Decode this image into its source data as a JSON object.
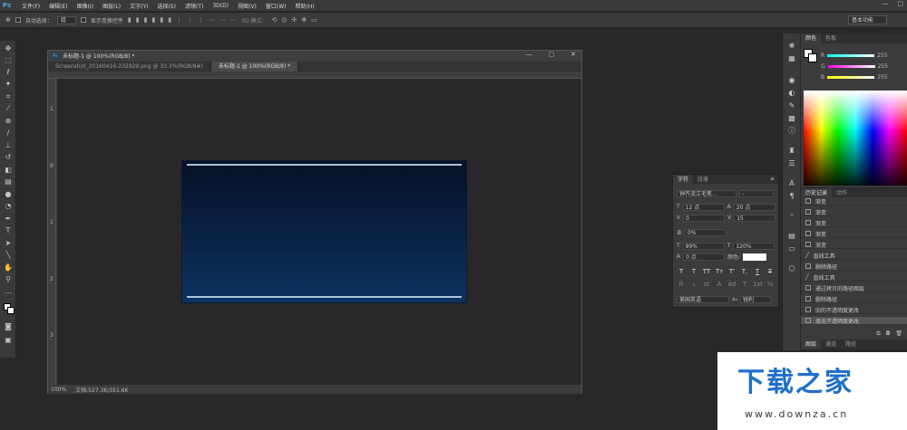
{
  "app": {
    "logo": "Ps",
    "window_controls": [
      "—",
      "▢"
    ]
  },
  "menu": [
    "文件(F)",
    "编辑(E)",
    "图像(I)",
    "图层(L)",
    "文字(Y)",
    "选择(S)",
    "滤镜(T)",
    "3D(D)",
    "视图(V)",
    "窗口(W)",
    "帮助(H)"
  ],
  "options": {
    "auto_select_label": "自动选择：",
    "auto_select_value": "组",
    "show_transform_label": "显示变换控件",
    "mode_3d_label": "3D 模式：",
    "workspace": "基本功能"
  },
  "document": {
    "title": "未标题-1 @ 100%(RGB/8) *",
    "window_controls": [
      "—",
      "▢",
      "✕"
    ],
    "tabs": [
      "Screenshot_20160416-232929.png @ 33.3%(RGB/8#)",
      "未标题-1 @ 100%(RGB/8) *"
    ],
    "ruler_left": [
      "1",
      "0",
      "1",
      "2",
      "3"
    ],
    "zoom": "100%",
    "doc_info": "文档:527.3K/351.6K"
  },
  "color_panel": {
    "tabs": [
      "颜色",
      "色板"
    ],
    "values": [
      "255",
      "255",
      "255"
    ],
    "labels": [
      "R",
      "G",
      "B"
    ]
  },
  "history_panel": {
    "tabs": [
      "历史记录",
      "动作"
    ],
    "items": [
      "渐变",
      "渐变",
      "渐变",
      "渐变",
      "渐变",
      "直线工具",
      "删除路径",
      "直线工具",
      "通过拷贝的路径图层",
      "删除路径",
      "旧的不透明度更改",
      "填充不透明度更改"
    ]
  },
  "layers_tabs": [
    "图层",
    "通道",
    "路径"
  ],
  "char_panel": {
    "tabs": [
      "字符",
      "段落"
    ],
    "font_family": "钟齐流江毛笔...",
    "font_style": "-",
    "font_size": "12 点",
    "leading": "20 点",
    "kerning": "0",
    "tracking": "15",
    "scale_percent": "0%",
    "vscale": "99%",
    "hscale": "120%",
    "baseline": "0 点",
    "color_label": "颜色:",
    "language": "美国英语",
    "anti_alias": "锐利",
    "style_buttons": [
      "T",
      "T",
      "TT",
      "Tт",
      "T'",
      "T,",
      "T",
      "T"
    ],
    "ot_buttons": [
      "fi",
      "ℴ",
      "st",
      "A",
      "ād",
      "T",
      "1st",
      "½"
    ]
  },
  "watermark": {
    "title": "下载之家",
    "url": "www.downza.cn"
  }
}
